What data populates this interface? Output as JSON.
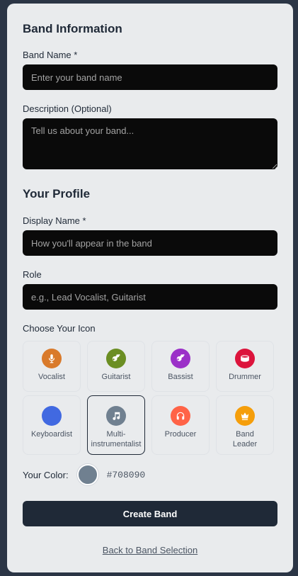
{
  "band_info": {
    "heading": "Band Information",
    "name_label": "Band Name *",
    "name_placeholder": "Enter your band name",
    "description_label": "Description (Optional)",
    "description_placeholder": "Tell us about your band..."
  },
  "profile": {
    "heading": "Your Profile",
    "display_name_label": "Display Name *",
    "display_name_placeholder": "How you'll appear in the band",
    "role_label": "Role",
    "role_placeholder": "e.g., Lead Vocalist, Guitarist"
  },
  "icons": {
    "label": "Choose Your Icon",
    "items": [
      {
        "label": "Vocalist",
        "color": "#d97a2b",
        "icon": "microphone-icon"
      },
      {
        "label": "Guitarist",
        "color": "#6b8e23",
        "icon": "guitar-icon"
      },
      {
        "label": "Bassist",
        "color": "#9b30c8",
        "icon": "bass-guitar-icon"
      },
      {
        "label": "Drummer",
        "color": "#dc143c",
        "icon": "drum-icon"
      },
      {
        "label": "Keyboardist",
        "color": "#4169e1",
        "icon": "keyboard-icon"
      },
      {
        "label": "Multi-\ninstrumentalist",
        "color": "#708090",
        "icon": "music-note-icon",
        "selected": true
      },
      {
        "label": "Producer",
        "color": "#ff6347",
        "icon": "headphones-icon"
      },
      {
        "label": "Band\nLeader",
        "color": "#f59e0b",
        "icon": "crown-icon"
      }
    ]
  },
  "color": {
    "label": "Your Color:",
    "value": "#708090"
  },
  "actions": {
    "create_label": "Create Band",
    "back_label": "Back to Band Selection"
  }
}
